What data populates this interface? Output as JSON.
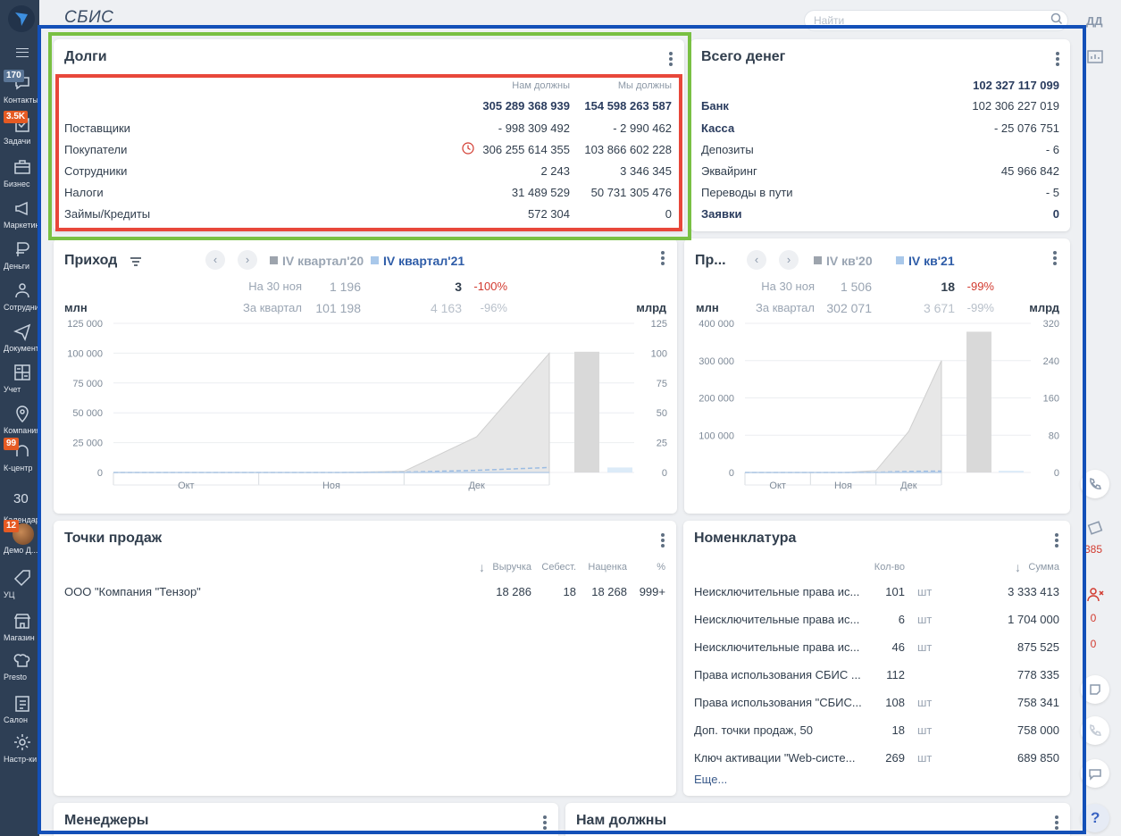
{
  "app": {
    "brand": "СБИС",
    "search_placeholder": "Найти",
    "user_initials": "ДД"
  },
  "sidebar": {
    "items": [
      {
        "label": "Контакты",
        "badge": "170",
        "icon": "chat-icon"
      },
      {
        "label": "Задачи",
        "badge": "3.5K",
        "icon": "checkbox-icon"
      },
      {
        "label": "Бизнес",
        "icon": "briefcase-icon"
      },
      {
        "label": "Маркетинг",
        "icon": "megaphone-icon"
      },
      {
        "label": "Деньги",
        "icon": "coins-icon"
      },
      {
        "label": "Сотрудники",
        "icon": "people-icon"
      },
      {
        "label": "Документы",
        "icon": "paper-plane-icon"
      },
      {
        "label": "Учет",
        "icon": "calculator-icon"
      },
      {
        "label": "Компания",
        "icon": "map-pin-icon"
      },
      {
        "label": "К-центр",
        "badge": "99",
        "icon": "headset-icon"
      },
      {
        "label": "Календарь",
        "number": "30",
        "icon": "calendar-icon"
      },
      {
        "label": "Демо Д...",
        "badge": "12",
        "icon": "avatar"
      },
      {
        "label": "УЦ",
        "icon": "tag-icon"
      },
      {
        "label": "Магазин",
        "icon": "store-icon"
      },
      {
        "label": "Presto",
        "icon": "chef-hat-icon"
      },
      {
        "label": "Салон",
        "icon": "clipboard-icon"
      },
      {
        "label": "Настр-ки",
        "icon": "gear-icon"
      }
    ]
  },
  "debts": {
    "title": "Долги",
    "col_owed_to_us": "Нам должны",
    "col_we_owe": "Мы должны",
    "total_owed_to_us": "305 289 368 939",
    "total_we_owe": "154 598 263 587",
    "rows": [
      {
        "label": "Поставщики",
        "owed_to_us": "- 998 309 492",
        "we_owe": "- 2 990 462"
      },
      {
        "label": "Покупатели",
        "owed_to_us": "306 255 614 355",
        "we_owe": "103 866 602 228"
      },
      {
        "label": "Сотрудники",
        "owed_to_us": "2 243",
        "we_owe": "3 346 345"
      },
      {
        "label": "Налоги",
        "owed_to_us": "31 489 529",
        "we_owe": "50 731 305 476"
      },
      {
        "label": "Займы/Кредиты",
        "owed_to_us": "572 304",
        "we_owe": "0"
      }
    ]
  },
  "total_money": {
    "title": "Всего денег",
    "total": "102 327 117 099",
    "rows": [
      {
        "label": "Банк",
        "value": "102 306 227 019"
      },
      {
        "label": "Касса",
        "value": "- 25 076 751"
      },
      {
        "label": "Депозиты",
        "value": "- 6"
      },
      {
        "label": "Эквайринг",
        "value": "45 966 842"
      },
      {
        "label": "Переводы в пути",
        "value": "- 5"
      },
      {
        "label": "Заявки",
        "value": "0"
      }
    ]
  },
  "income": {
    "title": "Приход",
    "legend_prev": "IV квартал'20",
    "legend_curr": "IV квартал'21",
    "row1_label": "На 30 ноя",
    "row1_prev": "1 196",
    "row1_curr": "3",
    "row1_delta": "-100%",
    "row2_label": "За квартал",
    "row2_prev": "101 198",
    "row2_curr": "4 163",
    "row2_delta": "-96%",
    "unit_left": "млн",
    "unit_right": "млрд"
  },
  "income2": {
    "title": "Пр...",
    "legend_prev": "IV кв'20",
    "legend_curr": "IV кв'21",
    "row1_label": "На 30 ноя",
    "row1_prev": "1 506",
    "row1_curr": "18",
    "row1_delta": "-99%",
    "row2_label": "За квартал",
    "row2_prev": "302 071",
    "row2_curr": "3 671",
    "row2_delta": "-99%",
    "unit_left": "млн",
    "unit_right": "млрд"
  },
  "chart_data": [
    {
      "type": "area",
      "categories": [
        "Окт",
        "Ноя",
        "Дек"
      ],
      "y_ticks": [
        "0",
        "25 000",
        "50 000",
        "75 000",
        "100 000",
        "125 000"
      ],
      "y_right_ticks": [
        "0",
        "25",
        "50",
        "75",
        "100",
        "125"
      ],
      "ylim": [
        0,
        125000
      ],
      "y_right_lim": [
        0,
        125
      ],
      "x": [
        0,
        0.5,
        1,
        1.5,
        2,
        2.5,
        3
      ],
      "series": [
        {
          "name": "IV квартал'20",
          "values": [
            0,
            0,
            0,
            0,
            1000,
            30000,
            100000
          ],
          "color": "#d9d9d9"
        },
        {
          "name": "IV квартал'21",
          "values": [
            0,
            0,
            0,
            0,
            300,
            1800,
            4163
          ],
          "color": "#a9c8ea"
        }
      ],
      "bars": [
        {
          "name": "IV квартал'20",
          "value": 101.2,
          "color": "#d9d9d9"
        },
        {
          "name": "IV квартал'21",
          "value": 4.2,
          "color": "#dcebf8"
        }
      ]
    },
    {
      "type": "area",
      "categories": [
        "Окт",
        "Ноя",
        "Дек"
      ],
      "y_ticks": [
        "0",
        "100 000",
        "200 000",
        "300 000",
        "400 000"
      ],
      "y_right_ticks": [
        "0",
        "80",
        "160",
        "240",
        "320"
      ],
      "ylim": [
        0,
        400000
      ],
      "y_right_lim": [
        0,
        320
      ],
      "x": [
        0,
        0.5,
        1,
        1.5,
        2,
        2.5,
        3
      ],
      "series": [
        {
          "name": "IV кв'20",
          "values": [
            0,
            0,
            0,
            0,
            5000,
            110000,
            300000
          ],
          "color": "#d9d9d9"
        },
        {
          "name": "IV кв'21",
          "values": [
            0,
            0,
            0,
            0,
            500,
            3000,
            3671
          ],
          "color": "#a9c8ea"
        }
      ],
      "bars": [
        {
          "name": "IV кв'20",
          "value": 302,
          "color": "#d9d9d9"
        },
        {
          "name": "IV кв'21",
          "value": 3.7,
          "color": "#dcebf8"
        }
      ]
    }
  ],
  "sales_points": {
    "title": "Точки продаж",
    "headers": [
      "Выручка",
      "Себест.",
      "Наценка",
      "%"
    ],
    "rows": [
      {
        "name": "ООО \"Компания \"Тензор\"",
        "revenue": "18 286",
        "cost": "18",
        "markup": "18 268",
        "percent": "999+"
      }
    ]
  },
  "nomenclature": {
    "title": "Номенклатура",
    "col_qty": "Кол-во",
    "col_sum": "Сумма",
    "rows": [
      {
        "name": "Неисключительные права ис...",
        "qty": "101",
        "unit": "шт",
        "sum": "3 333 413"
      },
      {
        "name": "Неисключительные права ис...",
        "qty": "6",
        "unit": "шт",
        "sum": "1 704 000"
      },
      {
        "name": "Неисключительные права ис...",
        "qty": "46",
        "unit": "шт",
        "sum": "875 525"
      },
      {
        "name": "Права использования СБИС ...",
        "qty": "112",
        "unit": "",
        "sum": "778 335"
      },
      {
        "name": "Права использования \"СБИС...",
        "qty": "108",
        "unit": "шт",
        "sum": "758 341"
      },
      {
        "name": "Доп. точки продаж, 50",
        "qty": "18",
        "unit": "шт",
        "sum": "758 000"
      },
      {
        "name": "Ключ активации \"Web-систе...",
        "qty": "269",
        "unit": "шт",
        "sum": "689 850"
      }
    ],
    "more": "Еще..."
  },
  "managers": {
    "title": "Менеджеры"
  },
  "owed_to_us": {
    "title": "Нам должны"
  },
  "right_rail": {
    "count1": "385",
    "count2": "0",
    "count3": "0",
    "help": "?"
  }
}
